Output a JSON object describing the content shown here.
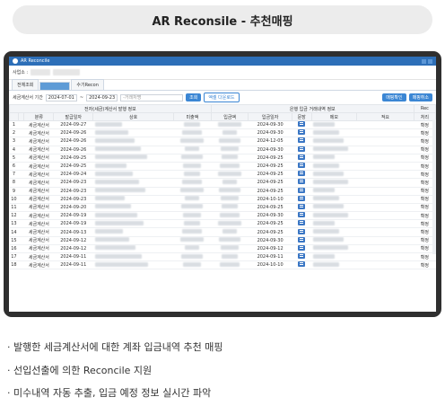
{
  "header": {
    "title": "AR Reconsile - 추천매핑"
  },
  "window": {
    "title": "AR Reconcile"
  },
  "bizbar": {
    "label": "사업소 :"
  },
  "tabs": [
    {
      "label": "전체조회",
      "active": false
    },
    {
      "label": "",
      "active": true
    },
    {
      "label": "수기Recon",
      "active": false
    }
  ],
  "search": {
    "date_label": "세금계산서 기간",
    "date_from": "2024-07-01",
    "sep": "~",
    "date_to": "2024-09-23",
    "vendor_placeholder": "-거래처명",
    "btn_search": "조회",
    "btn_excel": "엑셀 다운로드",
    "btn_right1": "매핑확인",
    "btn_right2": "매핑취소"
  },
  "table": {
    "group_left": "전자(세금)계산서 발행 정보",
    "group_right": "은행 입금 거래내역 정보",
    "group_far": "Rec",
    "headers": [
      "",
      "",
      "분류",
      "발급일자",
      "상호",
      "미출액",
      "입금액",
      "입금일자",
      "문장",
      "메모",
      "적요",
      "처리"
    ],
    "rows": [
      {
        "n": "1",
        "type": "세금계산서",
        "date": "2024-09-27",
        "in_date": "2024-09-30",
        "status": "확정"
      },
      {
        "n": "2",
        "type": "세금계산서",
        "date": "2024-09-26",
        "in_date": "2024-09-30",
        "status": "확정"
      },
      {
        "n": "3",
        "type": "세금계산서",
        "date": "2024-09-26",
        "in_date": "2024-12-05",
        "status": "확정"
      },
      {
        "n": "4",
        "type": "세금계산서",
        "date": "2024-09-26",
        "in_date": "2024-09-30",
        "status": "확정"
      },
      {
        "n": "5",
        "type": "세금계산서",
        "date": "2024-09-25",
        "in_date": "2024-09-25",
        "status": "확정"
      },
      {
        "n": "6",
        "type": "세금계산서",
        "date": "2024-09-25",
        "in_date": "2024-09-25",
        "status": "확정"
      },
      {
        "n": "7",
        "type": "세금계산서",
        "date": "2024-09-24",
        "in_date": "2024-09-25",
        "status": "확정"
      },
      {
        "n": "8",
        "type": "세금계산서",
        "date": "2024-09-23",
        "in_date": "2024-09-25",
        "status": "확정"
      },
      {
        "n": "9",
        "type": "세금계산서",
        "date": "2024-09-23",
        "in_date": "2024-09-25",
        "status": "확정"
      },
      {
        "n": "10",
        "type": "세금계산서",
        "date": "2024-09-23",
        "in_date": "2024-10-10",
        "status": "확정"
      },
      {
        "n": "11",
        "type": "세금계산서",
        "date": "2024-09-20",
        "in_date": "2024-09-25",
        "status": "확정"
      },
      {
        "n": "12",
        "type": "세금계산서",
        "date": "2024-09-19",
        "in_date": "2024-09-30",
        "status": "확정"
      },
      {
        "n": "13",
        "type": "세금계산서",
        "date": "2024-09-19",
        "in_date": "2024-09-25",
        "status": "확정"
      },
      {
        "n": "14",
        "type": "세금계산서",
        "date": "2024-09-13",
        "in_date": "2024-09-25",
        "status": "확정"
      },
      {
        "n": "15",
        "type": "세금계산서",
        "date": "2024-09-12",
        "in_date": "2024-09-30",
        "status": "확정"
      },
      {
        "n": "16",
        "type": "세금계산서",
        "date": "2024-09-12",
        "in_date": "2024-09-12",
        "status": "확정"
      },
      {
        "n": "17",
        "type": "세금계산서",
        "date": "2024-09-11",
        "in_date": "2024-09-11",
        "status": "확정"
      },
      {
        "n": "18",
        "type": "세금계산서",
        "date": "2024-09-11",
        "in_date": "2024-10-10",
        "status": "확정"
      }
    ]
  },
  "bullets": [
    "· 발행한 세금계산서에 대한 계좌 입금내역 추천 매핑",
    "· 선입선출에 의한 Reconcile 지원",
    "· 미수내역 자동 추출, 입금 예정 정보 실시간 파악"
  ]
}
